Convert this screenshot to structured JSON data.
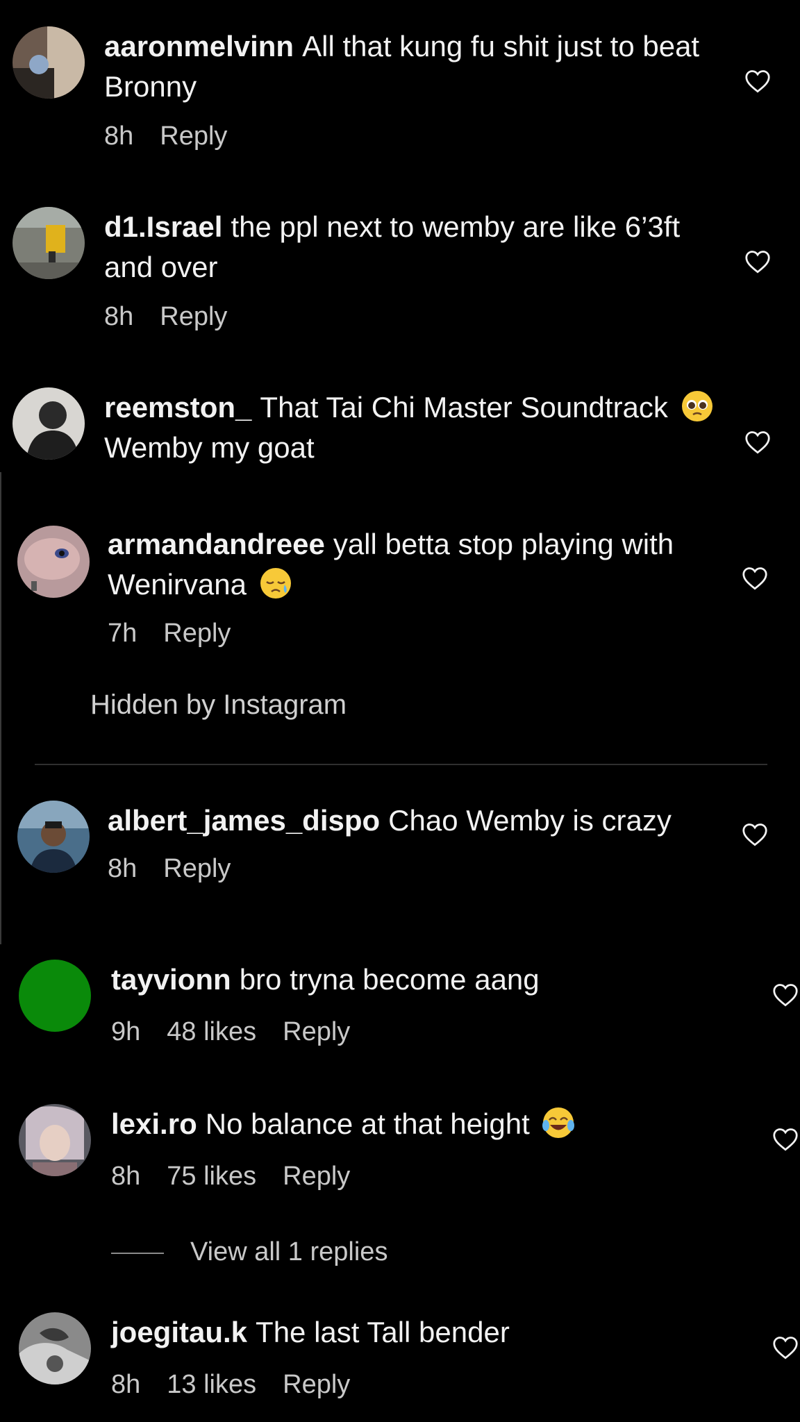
{
  "comments": [
    {
      "username": "aaronmelvinn",
      "text": "All that kung fu shit just to beat Bronny",
      "time": "8h",
      "likes": "",
      "reply": "Reply"
    },
    {
      "username": "d1.Israel",
      "text": "the ppl next to wemby are like 6’3ft and over",
      "time": "8h",
      "likes": "",
      "reply": "Reply"
    },
    {
      "username": "reemston_",
      "text": "That Tai Chi Master Soundtrack",
      "text_after_emoji": "Wemby my goat",
      "emoji": "pleading-face-emoji",
      "time": "",
      "likes": "",
      "reply": ""
    },
    {
      "username": "armandandreee",
      "text": "yall betta stop playing with Wenirvana",
      "emoji": "sad-relieved-face-emoji",
      "time": "7h",
      "likes": "",
      "reply": "Reply"
    },
    {
      "username": "albert_james_dispo",
      "text": "Chao Wemby is crazy",
      "time": "8h",
      "likes": "",
      "reply": "Reply"
    },
    {
      "username": "tayvionn",
      "text": "bro tryna become aang",
      "time": "9h",
      "likes": "48 likes",
      "reply": "Reply"
    },
    {
      "username": "lexi.ro",
      "text": "No balance at that height",
      "emoji": "tears-of-joy-emoji",
      "time": "8h",
      "likes": "75 likes",
      "reply": "Reply"
    },
    {
      "username": "joegitau.k",
      "text": "The last Tall bender",
      "time": "8h",
      "likes": "13 likes",
      "reply": "Reply"
    }
  ],
  "hidden_note": "Hidden by Instagram",
  "view_replies": "View all 1 replies",
  "colors": {
    "background": "#000000",
    "text": "#f2f2f2",
    "meta": "#c9c9c9",
    "green_avatar": "#0a8a0a"
  },
  "icons": [
    "heart-outline-icon",
    "avatar"
  ]
}
